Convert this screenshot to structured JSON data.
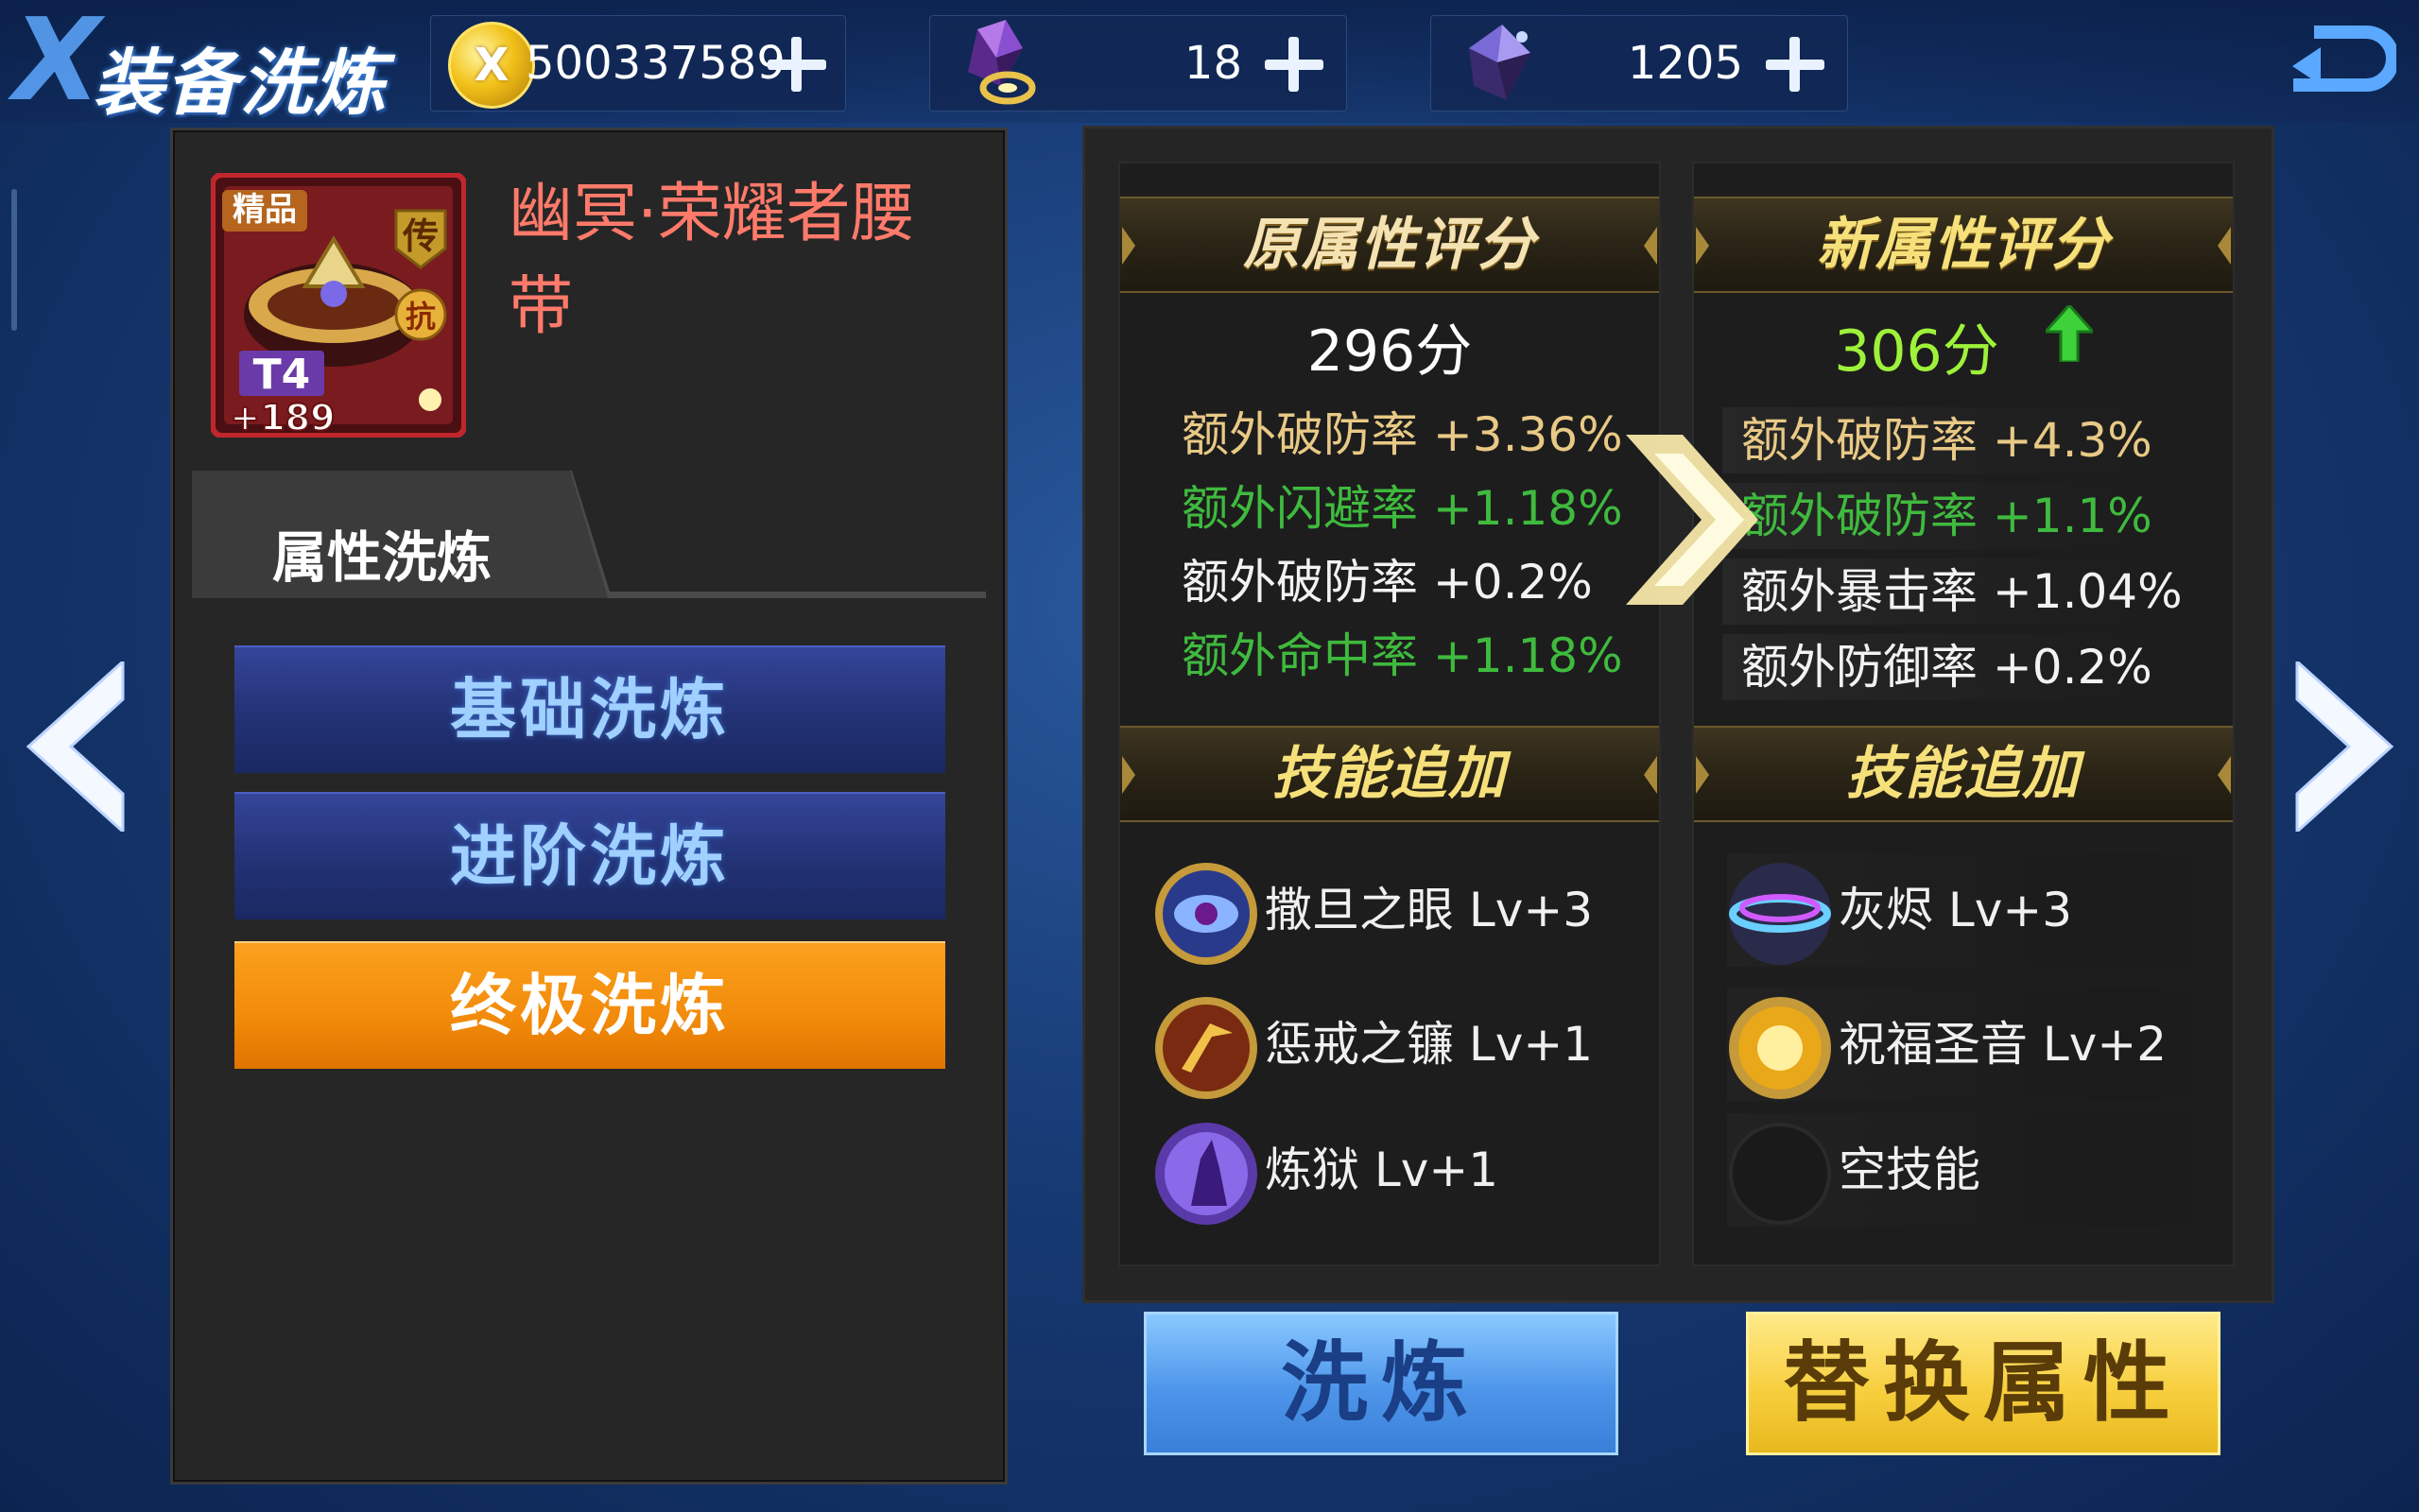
{
  "header": {
    "title": "装备洗炼",
    "gold_value": "500337589",
    "gem1_value": "18",
    "gem2_value": "1205"
  },
  "equipment": {
    "name": "幽冥·荣耀者腰带",
    "quality_badge": "精品",
    "legend_badge": "传",
    "resist_badge": "抗",
    "tier": "T4",
    "enhance": "+189"
  },
  "left_panel": {
    "tab_label": "属性洗炼",
    "buttons": [
      "基础洗炼",
      "进阶洗炼",
      "终极洗炼"
    ],
    "selected": "终极洗炼"
  },
  "old_attrs": {
    "header": "原属性评分",
    "score": "296分",
    "attributes": [
      {
        "text": "额外破防率 +3.36%",
        "color": "gold"
      },
      {
        "text": "额外闪避率 +1.18%",
        "color": "green"
      },
      {
        "text": "额外破防率 +0.2%",
        "color": "white"
      },
      {
        "text": "额外命中率 +1.18%",
        "color": "green"
      }
    ],
    "skill_header": "技能追加",
    "skills": [
      {
        "name": "撒旦之眼 Lv+3",
        "icon": "eye-skill-icon"
      },
      {
        "name": "惩戒之镰 Lv+1",
        "icon": "scythe-skill-icon"
      },
      {
        "name": "炼狱 Lv+1",
        "icon": "purgatory-skill-icon"
      }
    ]
  },
  "new_attrs": {
    "header": "新属性评分",
    "score": "306分",
    "attributes": [
      {
        "text": "额外破防率 +4.3%",
        "color": "gold"
      },
      {
        "text": "额外破防率 +1.1%",
        "color": "green"
      },
      {
        "text": "额外暴击率 +1.04%",
        "color": "white"
      },
      {
        "text": "额外防御率 +0.2%",
        "color": "white"
      }
    ],
    "skill_header": "技能追加",
    "skills": [
      {
        "name": "灰烬 Lv+3",
        "icon": "ash-skill-icon"
      },
      {
        "name": "祝福圣音 Lv+2",
        "icon": "blessing-skill-icon"
      },
      {
        "name": "空技能",
        "icon": "empty-skill-icon"
      }
    ]
  },
  "actions": {
    "wash": "洗炼",
    "replace": "替换属性"
  },
  "colors": {
    "gold_text": "#e8c985",
    "green_text": "#3fba3e",
    "new_score": "#9ef23a",
    "orange_button": "#f28a0a",
    "blue_button": "#4d95ea",
    "yellow_button": "#f7cf3e"
  }
}
